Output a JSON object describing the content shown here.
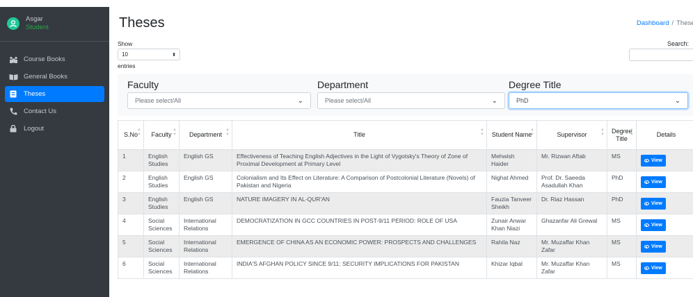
{
  "user": {
    "name": "Asgar",
    "role": "Student"
  },
  "nav": [
    {
      "label": "Course Books",
      "icon": "people-icon",
      "active": false
    },
    {
      "label": "General Books",
      "icon": "book-icon",
      "active": false
    },
    {
      "label": "Theses",
      "icon": "document-icon",
      "active": true
    },
    {
      "label": "Contact Us",
      "icon": "phone-icon",
      "active": false
    },
    {
      "label": "Logout",
      "icon": "lock-icon",
      "active": false
    }
  ],
  "page": {
    "title": "Theses"
  },
  "breadcrumb": {
    "home": "Dashboard",
    "sep": "/",
    "current": "Theses"
  },
  "controls": {
    "show": "Show",
    "entries_value": "10",
    "entries": "entries",
    "search": "Search:"
  },
  "filters": {
    "faculty": {
      "label": "Faculty",
      "value": "Please select/All"
    },
    "department": {
      "label": "Department",
      "value": "Please select/All"
    },
    "degree": {
      "label": "Degree Title",
      "value": "PhD"
    }
  },
  "table": {
    "headers": [
      "S.No",
      "Faculty",
      "Department",
      "Title",
      "Student Name",
      "Supervisor",
      "Degree Title",
      "Details"
    ],
    "view_label": "View",
    "rows": [
      [
        "1",
        "English Studies",
        "English GS",
        "Effectiveness of Teaching English Adjectives in the Light of Vygotsky's Theory of Zone of Proximal Development at Primary Level",
        "Mehwish Haider",
        "Mr. Rizwan Aftab",
        "MS"
      ],
      [
        "2",
        "English Studies",
        "English GS",
        "Colonialism and Its Effect on Literature: A Comparison of Postcolonial Literature (Novels) of Pakistan and Nigeria",
        "Nighat Ahmed",
        "Prof. Dr. Saeeda Asadullah Khan",
        "PhD"
      ],
      [
        "3",
        "English Studies",
        "English GS",
        "NATURE IMAGERY IN AL-QUR'AN",
        "Fauzia Tanveer Sheikh",
        "Dr. Riaz Hassan",
        "PhD"
      ],
      [
        "4",
        "Social Sciences",
        "International Relations",
        "DEMOCRATIZATION IN GCC COUNTRIES IN POST-9/11 PERIOD: ROLE OF USA",
        "Zunair Anwar Khan Niazi",
        "Ghazanfar Ali Grewal",
        "MS"
      ],
      [
        "5",
        "Social Sciences",
        "International Relations",
        "EMERGENCE OF CHINA AS AN ECONOMIC POWER: PROSPECTS AND CHALLENGES",
        "Rahila Naz",
        "Mr. Muzaffar Khan Zafar",
        "MS"
      ],
      [
        "6",
        "Social Sciences",
        "International Relations",
        "INDIA'S AFGHAN POLICY SINCE 9/11: SECURITY IMPLICATIONS FOR PAKISTAN",
        "Khizar Iqbal",
        "Mr. Muzaffar Khan Zafar",
        "MS"
      ]
    ]
  },
  "colors": {
    "sidebar": "#343a40",
    "accent": "#007bff",
    "role": "#28a745"
  }
}
